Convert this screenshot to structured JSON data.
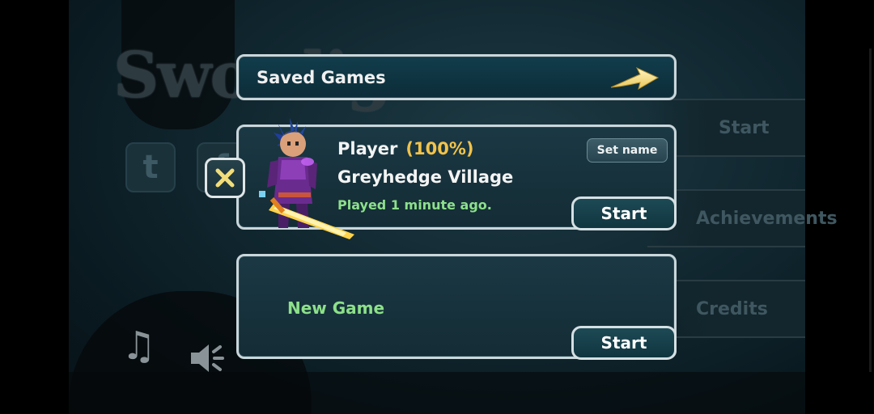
{
  "header": {
    "title": "Saved Games",
    "next_icon": "arrow-right-icon"
  },
  "save_slot": {
    "player_name": "Player",
    "progress": "(100%)",
    "location": "Greyhedge Village",
    "last_played": "Played 1 minute ago.",
    "set_name_label": "Set name",
    "start_label": "Start",
    "delete_icon": "close-icon"
  },
  "new_slot": {
    "label": "New Game",
    "start_label": "Start"
  },
  "background_menu": {
    "logo_text": "Swordigo",
    "items": [
      "Start",
      "Achievements",
      "Credits"
    ]
  },
  "colors": {
    "accent_green": "#8de08a",
    "accent_gold": "#f2c34a",
    "panel_border": "#c9d6da"
  }
}
